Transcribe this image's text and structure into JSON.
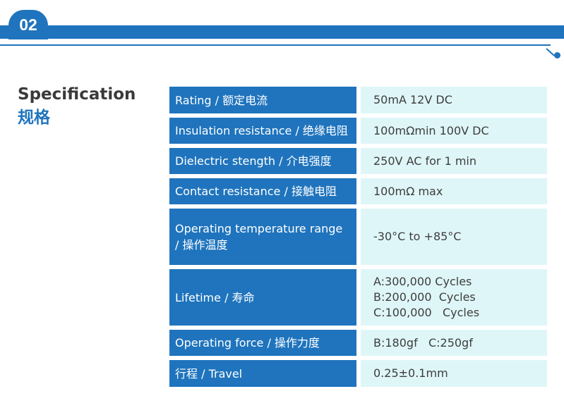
{
  "header": {
    "section_number": "02",
    "accent_color": "#1f74bd"
  },
  "section": {
    "title": "Specification",
    "subtitle": "规格"
  },
  "specs": [
    {
      "label_lines": [
        "Rating / 额定电流"
      ],
      "value_lines": [
        "50mA 12V DC"
      ]
    },
    {
      "label_lines": [
        "Insulation resistance / 绝缘电阻"
      ],
      "value_lines": [
        "100mΩmin 100V DC"
      ]
    },
    {
      "label_lines": [
        "Dielectric stength / 介电强度"
      ],
      "value_lines": [
        "250V AC for 1 min"
      ]
    },
    {
      "label_lines": [
        "Contact resistance / 接触电阻"
      ],
      "value_lines": [
        "100mΩ max"
      ]
    },
    {
      "label_lines": [
        "Operating temperature range",
        " / 操作温度"
      ],
      "value_lines": [
        "-30°C to +85°C"
      ]
    },
    {
      "label_lines": [
        "Lifetime / 寿命"
      ],
      "value_lines": [
        "A:300,000 Cycles",
        "B:200,000  Cycles",
        "C:100,000   Cycles"
      ]
    },
    {
      "label_lines": [
        "Operating force / 操作力度"
      ],
      "value_lines": [
        "B:180gf   C:250gf"
      ]
    },
    {
      "label_lines": [
        "行程 / Travel"
      ],
      "value_lines": [
        "0.25±0.1mm"
      ]
    }
  ]
}
